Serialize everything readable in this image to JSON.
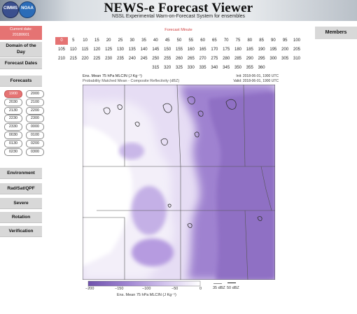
{
  "header": {
    "title": "NEWS-e Forecast Viewer",
    "subtitle": "NSSL Experimental Warn-on-Forecast System for ensembles",
    "logo1_label": "CIMMS",
    "logo2_label": "NOAA"
  },
  "sidebar": {
    "current_date_label": "Current date:",
    "current_date_value": "20180601",
    "domain_label": "Domain of the Day",
    "forecast_dates_label": "Forecast Dates",
    "forecasts_label": "Forecasts",
    "forecast_times": [
      "1900",
      "2000",
      "2030",
      "2100",
      "2130",
      "2200",
      "2230",
      "2300",
      "2330",
      "0000",
      "0030",
      "0100",
      "0130",
      "0200",
      "0230",
      "0300"
    ],
    "selected_forecast": "1900",
    "menu": [
      "Environment",
      "Rad/Sat/QPF",
      "Severe",
      "Rotation",
      "Verification"
    ]
  },
  "minutes": {
    "label": "Forecast Minute",
    "values": [
      "0",
      "5",
      "10",
      "15",
      "20",
      "25",
      "30",
      "35",
      "40",
      "45",
      "50",
      "55",
      "60",
      "65",
      "70",
      "75",
      "80",
      "85",
      "90",
      "95",
      "100",
      "105",
      "110",
      "115",
      "120",
      "125",
      "130",
      "135",
      "140",
      "145",
      "150",
      "155",
      "160",
      "165",
      "170",
      "175",
      "180",
      "185",
      "190",
      "195",
      "200",
      "205",
      "210",
      "215",
      "220",
      "225",
      "230",
      "235",
      "240",
      "245",
      "250",
      "255",
      "260",
      "265",
      "270",
      "275",
      "280",
      "285",
      "290",
      "295",
      "300",
      "305",
      "310",
      "315",
      "320",
      "325",
      "330",
      "335",
      "340",
      "345",
      "350",
      "355",
      "360"
    ],
    "selected": "0"
  },
  "members_label": "Members",
  "map": {
    "title1": "Ens. Mean 75 hPa MLCIN (J Kg⁻¹)",
    "title2": "Probability Matched Mean - Composite Reflectivity (dBZ)",
    "init": "Init: 2018-06-01, 1900 UTC",
    "valid": "Valid: 2018-06-01, 1900 UTC",
    "colorbar_ticks": [
      "−200",
      "−150",
      "−100",
      "−50",
      "0"
    ],
    "colorbar_label": "Ens. Mean 75 hPa MLCIN (J Kg⁻¹)",
    "legend_35": "35 dBZ",
    "legend_50": "50 dBZ",
    "colors": {
      "purple_dark": "#8f6fc4",
      "purple_mid": "#b69be0",
      "purple_light": "#d9ccef",
      "highlight": "#e57373"
    }
  }
}
